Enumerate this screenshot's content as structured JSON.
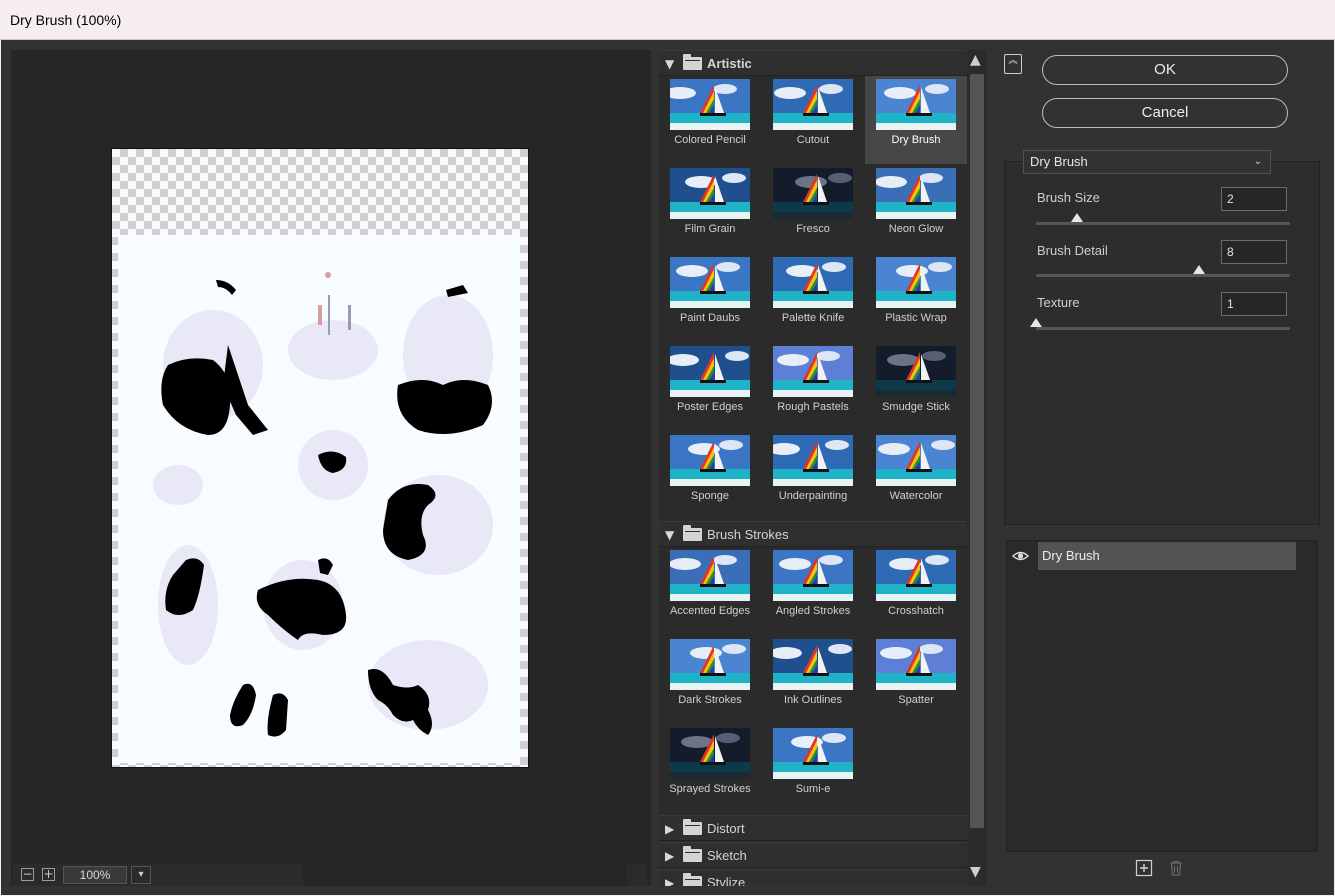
{
  "window": {
    "title": "Dry Brush (100%)"
  },
  "preview": {
    "zoom": "100%"
  },
  "gallery": {
    "categories": [
      {
        "name": "Artistic",
        "expanded": true,
        "filters": [
          "Colored Pencil",
          "Cutout",
          "Dry Brush",
          "Film Grain",
          "Fresco",
          "Neon Glow",
          "Paint Daubs",
          "Palette Knife",
          "Plastic Wrap",
          "Poster Edges",
          "Rough Pastels",
          "Smudge Stick",
          "Sponge",
          "Underpainting",
          "Watercolor"
        ]
      },
      {
        "name": "Brush Strokes",
        "expanded": true,
        "filters": [
          "Accented Edges",
          "Angled Strokes",
          "Crosshatch",
          "Dark Strokes",
          "Ink Outlines",
          "Spatter",
          "Sprayed Strokes",
          "Sumi-e"
        ]
      },
      {
        "name": "Distort",
        "expanded": false,
        "filters": []
      },
      {
        "name": "Sketch",
        "expanded": false,
        "filters": []
      },
      {
        "name": "Stylize",
        "expanded": false,
        "filters": []
      }
    ],
    "selected": "Dry Brush"
  },
  "buttons": {
    "ok": "OK",
    "cancel": "Cancel"
  },
  "settings": {
    "filter": "Dry Brush",
    "params": [
      {
        "label": "Brush Size",
        "value": "2",
        "min": 0,
        "max": 10
      },
      {
        "label": "Brush Detail",
        "value": "8",
        "min": 0,
        "max": 10
      },
      {
        "label": "Texture",
        "value": "1",
        "min": 1,
        "max": 3
      }
    ]
  },
  "layers": [
    {
      "name": "Dry Brush",
      "visible": true
    }
  ]
}
